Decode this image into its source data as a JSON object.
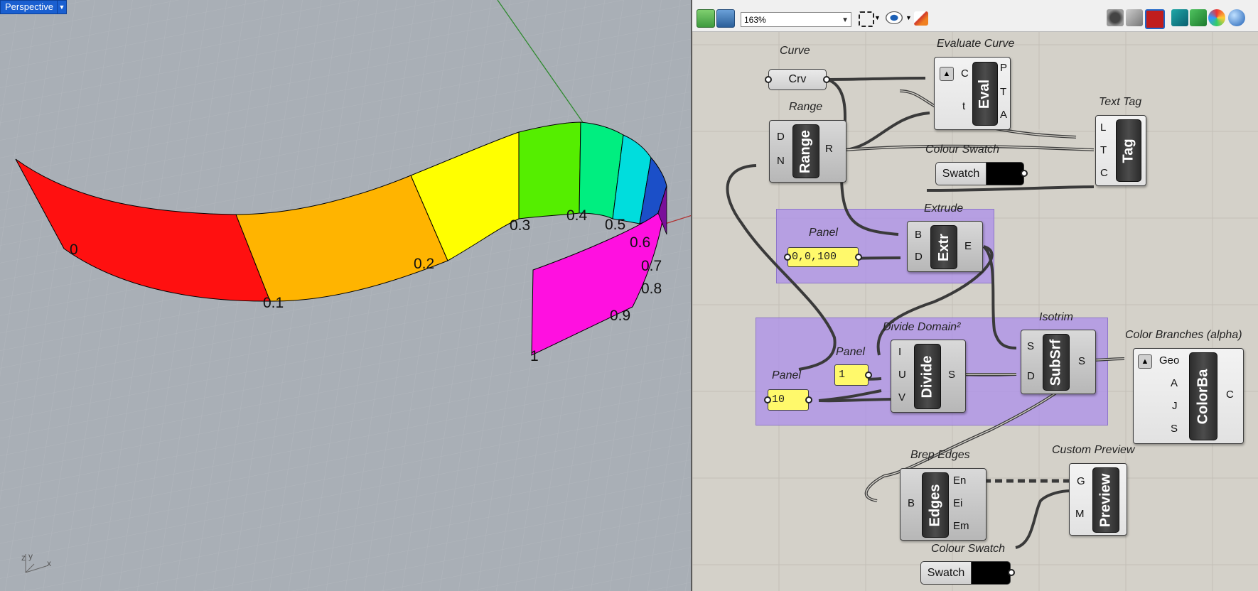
{
  "viewport": {
    "name": "Perspective",
    "axis_labels": {
      "x": "x",
      "y": "y",
      "z": "z"
    },
    "param_labels": [
      "0",
      "0.1",
      "0.2",
      "0.3",
      "0.4",
      "0.5",
      "0.6",
      "0.7",
      "0.8",
      "0.9",
      "1"
    ],
    "strip_colors": [
      "#ff1010",
      "#ffb400",
      "#ffff00",
      "#55ee00",
      "#00ee80",
      "#00dddd",
      "#1b4fc8",
      "#ff10e0"
    ]
  },
  "toolbar": {
    "zoom": "163%",
    "icons": [
      "open-file-icon",
      "save-icon",
      "zoom-extents-icon",
      "preview-eye-icon",
      "sketch-pen-icon",
      "no-preview-icon",
      "wireframe-icon",
      "shaded-preview-icon",
      "selected-only-icon",
      "mesh-icon",
      "shaded-icon",
      "material-icon",
      "sphere-icon"
    ]
  },
  "components": {
    "curve": {
      "title": "Curve",
      "label": "Crv"
    },
    "range": {
      "title": "Range",
      "core": "Range",
      "inputs": [
        "D",
        "N"
      ],
      "outputs": [
        "R"
      ]
    },
    "evaluate": {
      "title": "Evaluate Curve",
      "core": "Eval",
      "inputs": [
        "C",
        "t"
      ],
      "outputs": [
        "P",
        "T",
        "A"
      ]
    },
    "texttag": {
      "title": "Text Tag",
      "core": "Tag",
      "inputs": [
        "L",
        "T",
        "C"
      ]
    },
    "swatch1": {
      "title": "Colour Swatch",
      "label": "Swatch",
      "color": "#000000"
    },
    "extrude": {
      "title": "Extrude",
      "core": "Extr",
      "inputs": [
        "B",
        "D"
      ],
      "outputs": [
        "E"
      ]
    },
    "panel_vec": {
      "title": "Panel",
      "value": "0,0,100"
    },
    "divide": {
      "title": "Divide Domain²",
      "core": "Divide",
      "inputs": [
        "I",
        "U",
        "V"
      ],
      "outputs": [
        "S"
      ]
    },
    "panel_u": {
      "title": "Panel",
      "value": "1"
    },
    "panel_v": {
      "title": "Panel",
      "value": "10"
    },
    "isotrim": {
      "title": "Isotrim",
      "core": "SubSrf",
      "inputs": [
        "S",
        "D"
      ],
      "outputs": [
        "S"
      ]
    },
    "colorbranches": {
      "title": "Color Branches (alpha)",
      "core": "ColorBa",
      "inputs": [
        "Geo",
        "A",
        "J",
        "S"
      ],
      "outputs": [
        "C"
      ]
    },
    "brepedges": {
      "title": "Brep Edges",
      "core": "Edges",
      "inputs": [
        "B"
      ],
      "outputs": [
        "En",
        "Ei",
        "Em"
      ]
    },
    "preview": {
      "title": "Custom Preview",
      "core": "Preview",
      "inputs": [
        "G",
        "M"
      ]
    },
    "swatch2": {
      "title": "Colour Swatch",
      "label": "Swatch",
      "color": "#000000"
    }
  }
}
